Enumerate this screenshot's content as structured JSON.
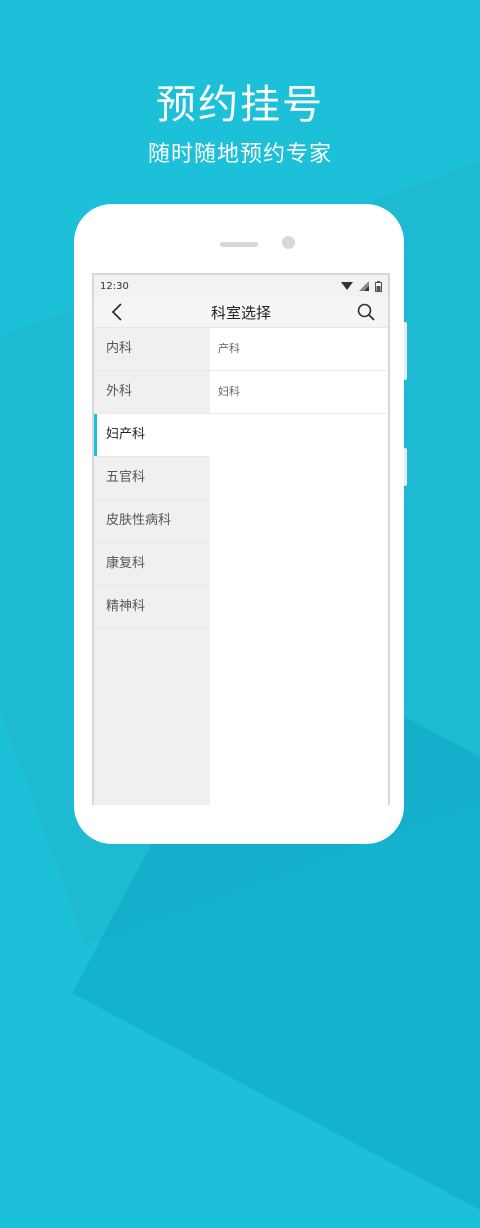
{
  "promo": {
    "headline": "预约挂号",
    "subline": "随时随地预约专家"
  },
  "status_bar": {
    "time": "12:30",
    "icons": [
      "wifi-icon",
      "signal-icon",
      "battery-icon"
    ]
  },
  "app_bar": {
    "title": "科室选择",
    "back_icon": "chevron-left-icon",
    "search_icon": "search-icon"
  },
  "departments": [
    {
      "label": "内科",
      "active": false
    },
    {
      "label": "外科",
      "active": false
    },
    {
      "label": "妇产科",
      "active": true
    },
    {
      "label": "五官科",
      "active": false
    },
    {
      "label": "皮肤性病科",
      "active": false
    },
    {
      "label": "康复科",
      "active": false
    },
    {
      "label": "精神科",
      "active": false
    }
  ],
  "sub_departments": [
    {
      "label": "产科"
    },
    {
      "label": "妇科"
    }
  ],
  "colors": {
    "accent": "#1cc1d9",
    "background": "#1cc1d9"
  }
}
